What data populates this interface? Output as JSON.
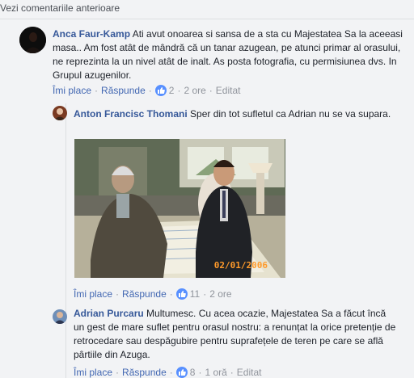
{
  "view_previous": "Vezi comentariile anterioare",
  "comments": [
    {
      "author": "Anca Faur-Kamp",
      "text": "Ati avut onoarea si sansa de a sta cu Majestatea Sa la aceeasi masa.. Am fost atât de mândră că un tanar azugean, pe atunci primar al orasului, ne reprezinta la un nivel atât de inalt. As posta fotografia, cu permisiunea dvs. In Grupul azugenilor.",
      "like_label": "Îmi place",
      "reply_label": "Răspunde",
      "reactions": "2",
      "time": "2 ore",
      "edited": "Editat"
    },
    {
      "author": "Anton Francisc Thomani",
      "text": "Sper din tot sufletul ca Adrian nu se va supara.",
      "photo_date": "02/01/2006",
      "like_label": "Îmi place",
      "reply_label": "Răspunde",
      "reactions": "11",
      "time": "2 ore"
    },
    {
      "author": "Adrian Purcaru",
      "text": "Multumesc. Cu acea ocazie, Majestatea Sa a făcut încă un gest de mare suflet pentru orasul nostru: a renunțat la orice pretenție de retrocedare sau despăgubire pentru suprafețele de teren pe care se află pârtiile din Azuga.",
      "like_label": "Îmi place",
      "reply_label": "Răspunde",
      "reactions": "8",
      "time": "1 oră",
      "edited": "Editat"
    }
  ],
  "colors": {
    "background": "#f2f3f5",
    "link": "#365899",
    "action": "#4267b2",
    "meta": "#90949c",
    "like_badge": "#5890ff"
  }
}
